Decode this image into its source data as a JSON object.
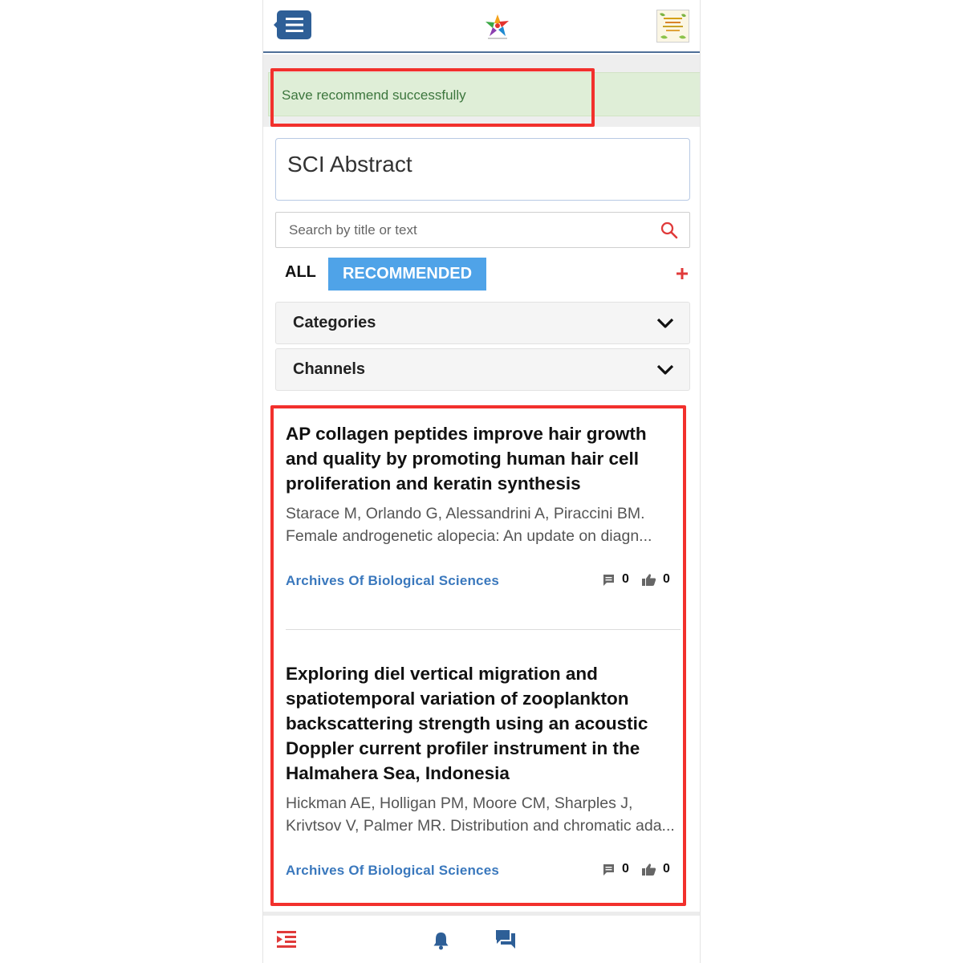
{
  "colors": {
    "header_blue": "#2e5f97",
    "accent_blue": "#4fa3e8",
    "link_blue": "#3a78bd",
    "success_bg": "#dfeed7",
    "success_text": "#3c763d",
    "highlight_red": "#f2302c",
    "plus_red": "#e03a3a"
  },
  "header": {
    "menu_icon": "hamburger-menu-icon",
    "logo_icon": "colorful-star-logo",
    "avatar_icon": "user-avatar-thumbnail"
  },
  "toast": {
    "message": "Save recommend successfully"
  },
  "page": {
    "title": "SCI Abstract"
  },
  "search": {
    "placeholder": "Search by title or text",
    "value": ""
  },
  "tabs": [
    {
      "label": "ALL",
      "active": false
    },
    {
      "label": "RECOMMENDED",
      "active": true
    }
  ],
  "filters": {
    "categories_label": "Categories",
    "channels_label": "Channels"
  },
  "articles": [
    {
      "title": "AP collagen peptides improve hair growth and quality by promoting human hair cell proliferation and keratin synthesis",
      "excerpt": "Starace M, Orlando G, Alessandrini A, Piraccini BM. Female androgenetic alopecia: An update on diagn...",
      "source": "Archives Of Biological Sciences",
      "comments": "0",
      "likes": "0"
    },
    {
      "title": "Exploring diel vertical migration and spatiotemporal variation of zooplankton backscattering strength using an acoustic Doppler current profiler instrument in the Halmahera Sea, Indonesia",
      "excerpt": "Hickman AE, Holligan PM, Moore CM, Sharples J, Krivtsov V, Palmer MR. Distribution and chromatic ada...",
      "source": "Archives Of Biological Sciences",
      "comments": "0",
      "likes": "0"
    }
  ],
  "bottom_nav": [
    {
      "icon": "list-indent-icon"
    },
    {
      "icon": "bell-icon"
    },
    {
      "icon": "chat-icon"
    }
  ]
}
